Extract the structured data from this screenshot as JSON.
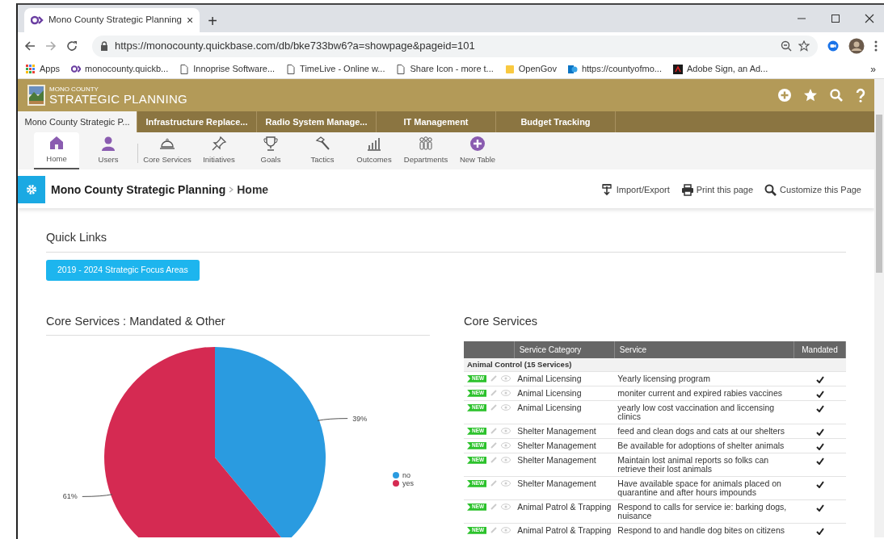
{
  "browser": {
    "tab": {
      "title": "Mono County Strategic Planning",
      "close": "×"
    },
    "new_tab": "+",
    "url": "https://monocounty.quickbase.com/db/bke733bw6?a=showpage&pageid=101",
    "bookmarks": [
      "Apps",
      "monocounty.quickb...",
      "Innoprise Software...",
      "TimeLive - Online w...",
      "Share Icon - more t...",
      "OpenGov",
      "https://countyofmo...",
      "Adobe Sign, an Ad..."
    ],
    "bookmarks_more": "»"
  },
  "app": {
    "logo": {
      "line1": "MONO COUNTY",
      "line2": "STRATEGIC PLANNING"
    },
    "app_tabs": [
      {
        "label": "Mono County Strategic P...",
        "selected": true
      },
      {
        "label": "Infrastructure Replace...",
        "selected": false
      },
      {
        "label": "Radio System Manage...",
        "selected": false
      },
      {
        "label": "IT Management",
        "selected": false
      },
      {
        "label": "Budget Tracking",
        "selected": false
      }
    ],
    "toolbar": {
      "user_items": [
        {
          "label": "Home",
          "selected": true
        },
        {
          "label": "Users",
          "selected": false
        }
      ],
      "table_items": [
        {
          "label": "Core Services",
          "selected": false
        },
        {
          "label": "Initiatives",
          "selected": false
        },
        {
          "label": "Goals",
          "selected": false
        },
        {
          "label": "Tactics",
          "selected": false
        },
        {
          "label": "Outcomes",
          "selected": false
        },
        {
          "label": "Departments",
          "selected": false
        },
        {
          "label": "New Table",
          "selected": false
        }
      ]
    },
    "breadcrumb": [
      "Mono County Strategic Planning",
      "Home"
    ],
    "actions": [
      "Import/Export",
      "Print this page",
      "Customize this Page"
    ],
    "quick_links": {
      "title": "Quick Links",
      "buttons": [
        "2019 - 2024 Strategic Focus Areas"
      ]
    },
    "pie_section": {
      "title": "Core Services : Mandated & Other",
      "chart_data": {
        "type": "pie",
        "categories": [
          "no",
          "yes"
        ],
        "values": [
          39,
          61
        ],
        "colors": [
          "#2a9be0",
          "#d52a52"
        ],
        "value_labels": [
          "39%",
          "61%"
        ],
        "legend": "right"
      }
    },
    "table_section": {
      "title": "Core Services",
      "columns": [
        "Service Category",
        "Service",
        "Mandated"
      ],
      "group": "Animal Control  (15 Services)",
      "rows": [
        {
          "badge": "NEW",
          "category": "Animal Licensing",
          "service": "Yearly licensing program",
          "mandated": true
        },
        {
          "badge": "NEW",
          "category": "Animal Licensing",
          "service": "moniter current and expired rabies vaccines",
          "mandated": true
        },
        {
          "badge": "NEW",
          "category": "Animal Licensing",
          "service": "yearly low cost vaccination and liccensing clinics",
          "mandated": true
        },
        {
          "badge": "NEW",
          "category": "Shelter Management",
          "service": "feed and clean dogs and cats at our shelters",
          "mandated": true
        },
        {
          "badge": "NEW",
          "category": "Shelter Management",
          "service": "Be available for adoptions of shelter animals",
          "mandated": true
        },
        {
          "badge": "NEW",
          "category": "Shelter Management",
          "service": "Maintain lost animal reports so folks can retrieve their lost animals",
          "mandated": true
        },
        {
          "badge": "NEW",
          "category": "Shelter Management",
          "service": "Have available space for animals placed on quarantine and after hours impounds",
          "mandated": true
        },
        {
          "badge": "NEW",
          "category": "Animal Patrol & Trapping",
          "service": "Respond to calls for service ie: barking dogs, nuisance",
          "mandated": true
        },
        {
          "badge": "NEW",
          "category": "Animal Patrol & Trapping",
          "service": "Respond to and handle dog bites on citizens",
          "mandated": true
        }
      ]
    }
  }
}
